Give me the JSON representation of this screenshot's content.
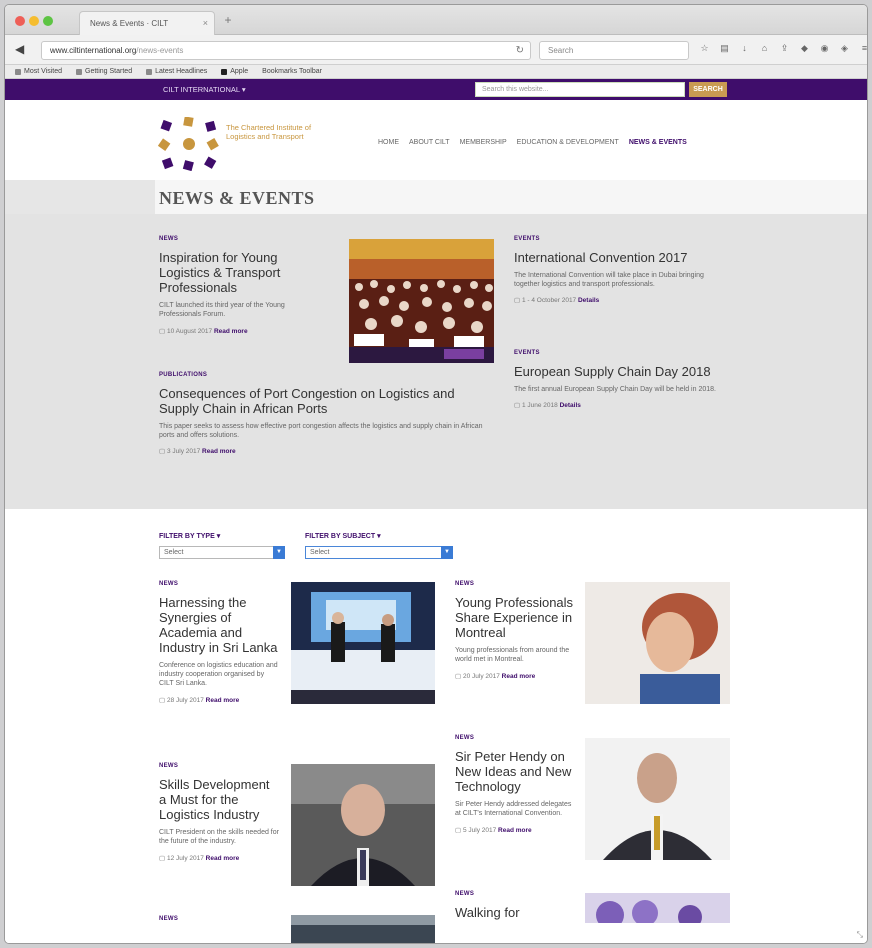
{
  "browser": {
    "tab_title": "News & Events · CILT",
    "tab_close": "×",
    "new_tab": "+",
    "back": "◀",
    "url_host": "www.ciltinternational.org",
    "url_rest": "/news-events",
    "reload": "↻",
    "search_placeholder": "Search",
    "bookmarks": [
      "Most Visited",
      "Getting Started",
      "Latest Headlines",
      "Apple",
      "Bookmarks Toolbar"
    ]
  },
  "topbar": {
    "text": "CILT INTERNATIONAL ▾",
    "search_placeholder": "Search this website...",
    "search_button": "SEARCH"
  },
  "logo": {
    "text": "The Chartered Institute of Logistics and Transport"
  },
  "nav": {
    "items": [
      "HOME",
      "ABOUT CILT",
      "MEMBERSHIP",
      "EDUCATION & DEVELOPMENT",
      "NEWS & EVENTS"
    ]
  },
  "page_title": "NEWS & EVENTS",
  "featured": {
    "main": {
      "category": "NEWS",
      "title": "Inspiration for Young Logistics & Transport Professionals",
      "excerpt": "CILT launched its third year of the Young Professionals Forum.",
      "meta": "10 August 2017",
      "meta_link": "Read more"
    },
    "wide": {
      "category": "PUBLICATIONS",
      "title": "Consequences of Port Congestion on Logistics and Supply Chain in African Ports",
      "excerpt": "This paper seeks to assess how effective port congestion affects the logistics and supply chain in African ports and offers solutions.",
      "meta": "3 July 2017",
      "meta_link": "Read more"
    },
    "side": [
      {
        "category": "EVENTS",
        "title": "International Convention 2017",
        "excerpt": "The International Convention will take place in Dubai bringing together logistics and transport professionals.",
        "meta": "1 - 4 October 2017",
        "meta_link": "Details"
      },
      {
        "category": "EVENTS",
        "title": "European Supply Chain Day 2018",
        "excerpt": "The first annual European Supply Chain Day will be held in 2018.",
        "meta": "1 June 2018",
        "meta_link": "Details"
      }
    ]
  },
  "filters": {
    "type_label": "FILTER BY TYPE ▾",
    "type_value": "Select",
    "subject_label": "FILTER BY SUBJECT ▾",
    "subject_value": "Select"
  },
  "articles": [
    {
      "category": "NEWS",
      "title": "Harnessing the Synergies of Academia and Industry in Sri Lanka",
      "excerpt": "Conference on logistics education and industry cooperation organised by CILT Sri Lanka.",
      "meta": "28 July 2017",
      "meta_link": "Read more"
    },
    {
      "category": "NEWS",
      "title": "Young Professionals Share Experience in Montreal",
      "excerpt": "Young professionals from around the world met in Montreal.",
      "meta": "20 July 2017",
      "meta_link": "Read more"
    },
    {
      "category": "NEWS",
      "title": "Skills Development a Must for the Logistics Industry",
      "excerpt": "CILT President on the skills needed for the future of the industry.",
      "meta": "12 July 2017",
      "meta_link": "Read more"
    },
    {
      "category": "NEWS",
      "title": "Sir Peter Hendy on New Ideas and New Technology",
      "excerpt": "Sir Peter Hendy addressed delegates at CILT's International Convention.",
      "meta": "5 July 2017",
      "meta_link": "Read more"
    },
    {
      "category": "NEWS",
      "title": "",
      "excerpt": "",
      "meta": "",
      "meta_link": ""
    },
    {
      "category": "NEWS",
      "title": "Walking for",
      "excerpt": "",
      "meta": "",
      "meta_link": ""
    }
  ],
  "colors": {
    "brand_purple": "#3f0d6b",
    "brand_gold": "#c99a52",
    "feature_gray": "#e3e3e3"
  }
}
